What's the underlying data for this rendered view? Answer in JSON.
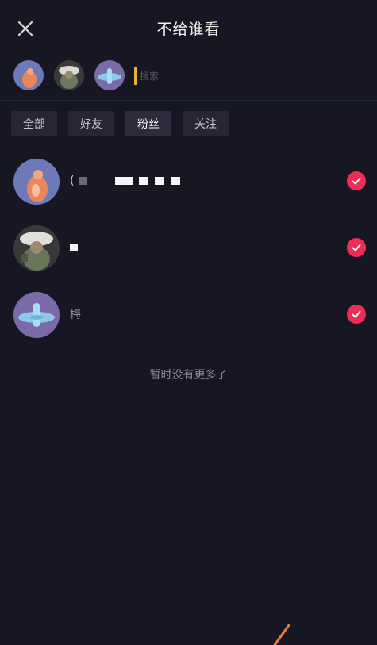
{
  "header": {
    "title": "不给谁看"
  },
  "selected": {
    "avatars": [
      {
        "name": "selected-avatar-1",
        "color": "#6d79b8",
        "accent": "#e9875b"
      },
      {
        "name": "selected-avatar-2",
        "color": "#3b3b3b",
        "accent": "#7c8a6c"
      },
      {
        "name": "selected-avatar-3",
        "color": "#7a6aa8",
        "accent": "#8cc9e8"
      }
    ],
    "search_placeholder": "搜索"
  },
  "filters": [
    {
      "label": "全部",
      "active": false
    },
    {
      "label": "好友",
      "active": false
    },
    {
      "label": "粉丝",
      "active": true
    },
    {
      "label": "关注",
      "active": false
    }
  ],
  "users": [
    {
      "prefix": "(",
      "checked": true
    },
    {
      "prefix": "",
      "checked": true
    },
    {
      "prefix": "梅",
      "checked": true
    }
  ],
  "empty_text": "暂时没有更多了",
  "colors": {
    "background": "#171724",
    "check": "#f02b56",
    "chip": "#262635"
  }
}
